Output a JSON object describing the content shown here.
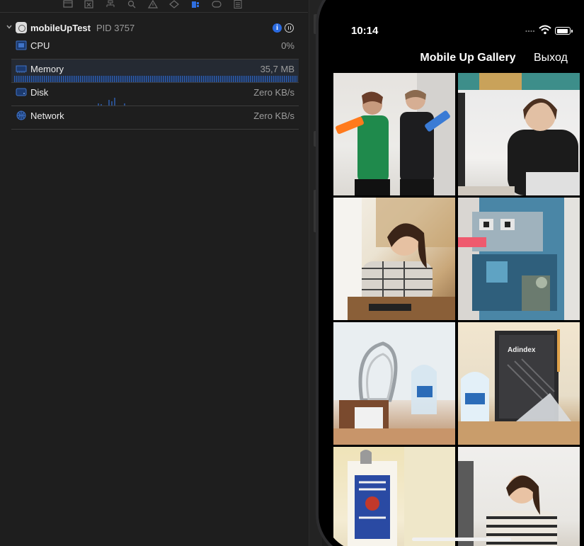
{
  "navigator": {
    "process": {
      "name": "mobileUpTest",
      "pid": "PID 3757"
    },
    "gauges": [
      {
        "label": "CPU",
        "value": "0%"
      },
      {
        "label": "Memory",
        "value": "35,7 MB"
      },
      {
        "label": "Disk",
        "value": "Zero KB/s"
      },
      {
        "label": "Network",
        "value": "Zero KB/s"
      }
    ],
    "toolbar_icons": [
      "folder-icon",
      "x-square-icon",
      "hierarchy-icon",
      "search-icon",
      "warning-icon",
      "diamond-icon",
      "debug-gauges-icon",
      "tag-icon",
      "list-icon"
    ],
    "accent_color": "#2a6ae0"
  },
  "phone": {
    "status": {
      "time": "10:14"
    },
    "nav": {
      "title": "Mobile Up Gallery",
      "exit_label": "Выход"
    },
    "photos": [
      "photo-two-women-with-blasters",
      "photo-man-at-desk",
      "photo-woman-at-laptop",
      "photo-pixel-art-robot",
      "photo-award-trophies",
      "photo-adindex-awards",
      "photo-employer-rating-diploma",
      "photo-smiling-woman-at-desk"
    ]
  }
}
